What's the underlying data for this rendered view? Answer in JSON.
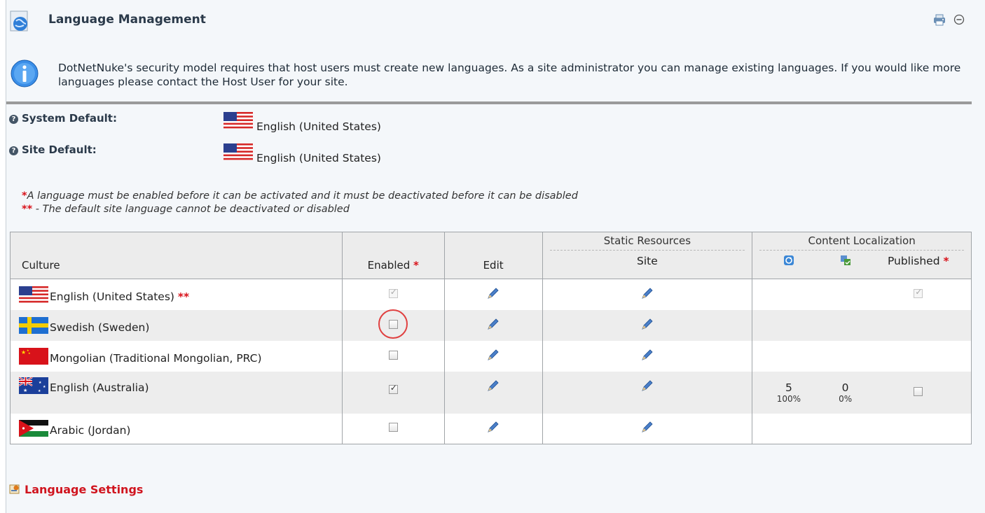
{
  "header": {
    "title": "Language Management",
    "print_icon": "print-icon",
    "collapse_icon": "collapse-icon"
  },
  "info": {
    "text": "DotNetNuke's security model requires that host users must create new languages. As a site administrator you can manage existing languages. If you would like more languages please contact the Host User for your site."
  },
  "defaults": {
    "system_label": "System Default:",
    "system_value": "English (United States)",
    "site_label": "Site Default:",
    "site_value": "English (United States)"
  },
  "notes": {
    "note1_star": "*",
    "note1": "A language must be enabled before it can be activated and it must be deactivated before it can be disabled",
    "note2_star": "**",
    "note2": " - The default site language cannot be deactivated or disabled"
  },
  "table": {
    "headers": {
      "culture": "Culture",
      "enabled": "Enabled",
      "enabled_star": "*",
      "edit": "Edit",
      "static_resources": "Static Resources",
      "site": "Site",
      "content_localization": "Content Localization",
      "published": "Published",
      "published_star": "*"
    },
    "rows": [
      {
        "culture": "English (United States)",
        "marker": "**",
        "flag": "us",
        "enabled": true,
        "enabled_disabled": true,
        "published_shown": true,
        "published": true,
        "published_disabled": true,
        "stats": null
      },
      {
        "culture": "Swedish (Sweden)",
        "marker": "",
        "flag": "se",
        "enabled": false,
        "enabled_disabled": false,
        "highlighted": true,
        "published_shown": false,
        "stats": null
      },
      {
        "culture": "Mongolian (Traditional Mongolian, PRC)",
        "marker": "",
        "flag": "cn",
        "enabled": false,
        "enabled_disabled": false,
        "published_shown": false,
        "stats": null
      },
      {
        "culture": "English (Australia)",
        "marker": "",
        "flag": "au",
        "enabled": true,
        "enabled_disabled": false,
        "published_shown": true,
        "published": false,
        "published_disabled": false,
        "stats": {
          "a_count": "5",
          "a_pct": "100%",
          "b_count": "0",
          "b_pct": "0%"
        }
      },
      {
        "culture": "Arabic (Jordan)",
        "marker": "",
        "flag": "jo",
        "enabled": false,
        "enabled_disabled": false,
        "published_shown": false,
        "stats": null
      }
    ]
  },
  "footer": {
    "language_settings": "Language Settings"
  },
  "colors": {
    "accent_red": "#d0141e",
    "title": "#2b3a4a",
    "rule": "#9a9a9a"
  }
}
